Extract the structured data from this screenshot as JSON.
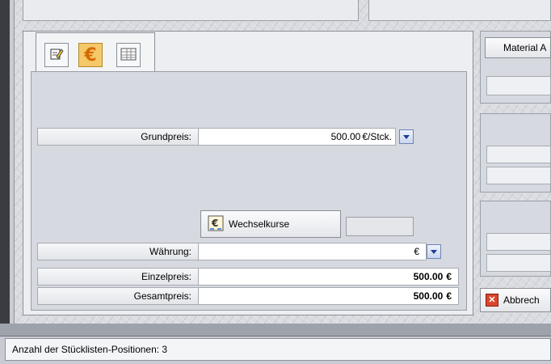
{
  "tabs": [
    {
      "icon": "edit-note-icon"
    },
    {
      "icon": "euro-icon"
    },
    {
      "icon": "table-icon"
    }
  ],
  "price_form": {
    "grundpreis_label": "Grundpreis:",
    "grundpreis_value": "500.00",
    "grundpreis_unit": "€/Stck.",
    "wechselkurse_label": "Wechselkurse",
    "waehrung_label": "Währung:",
    "waehrung_value": "€",
    "einzelpreis_label": "Einzelpreis:",
    "einzelpreis_value": "500.00",
    "einzelpreis_unit": "€",
    "gesamtpreis_label": "Gesamtpreis:",
    "gesamtpreis_value": "500.00",
    "gesamtpreis_unit": "€"
  },
  "right_panel": {
    "material_button_label": "Material A",
    "cancel_button_label": "Abbrech"
  },
  "status": {
    "text": "Anzahl der Stücklisten-Positionen: 3"
  },
  "colors": {
    "euro_tab": "#f5c86a",
    "dropdown_arrow": "#1d3f8f",
    "cancel_icon": "#d9452b"
  }
}
